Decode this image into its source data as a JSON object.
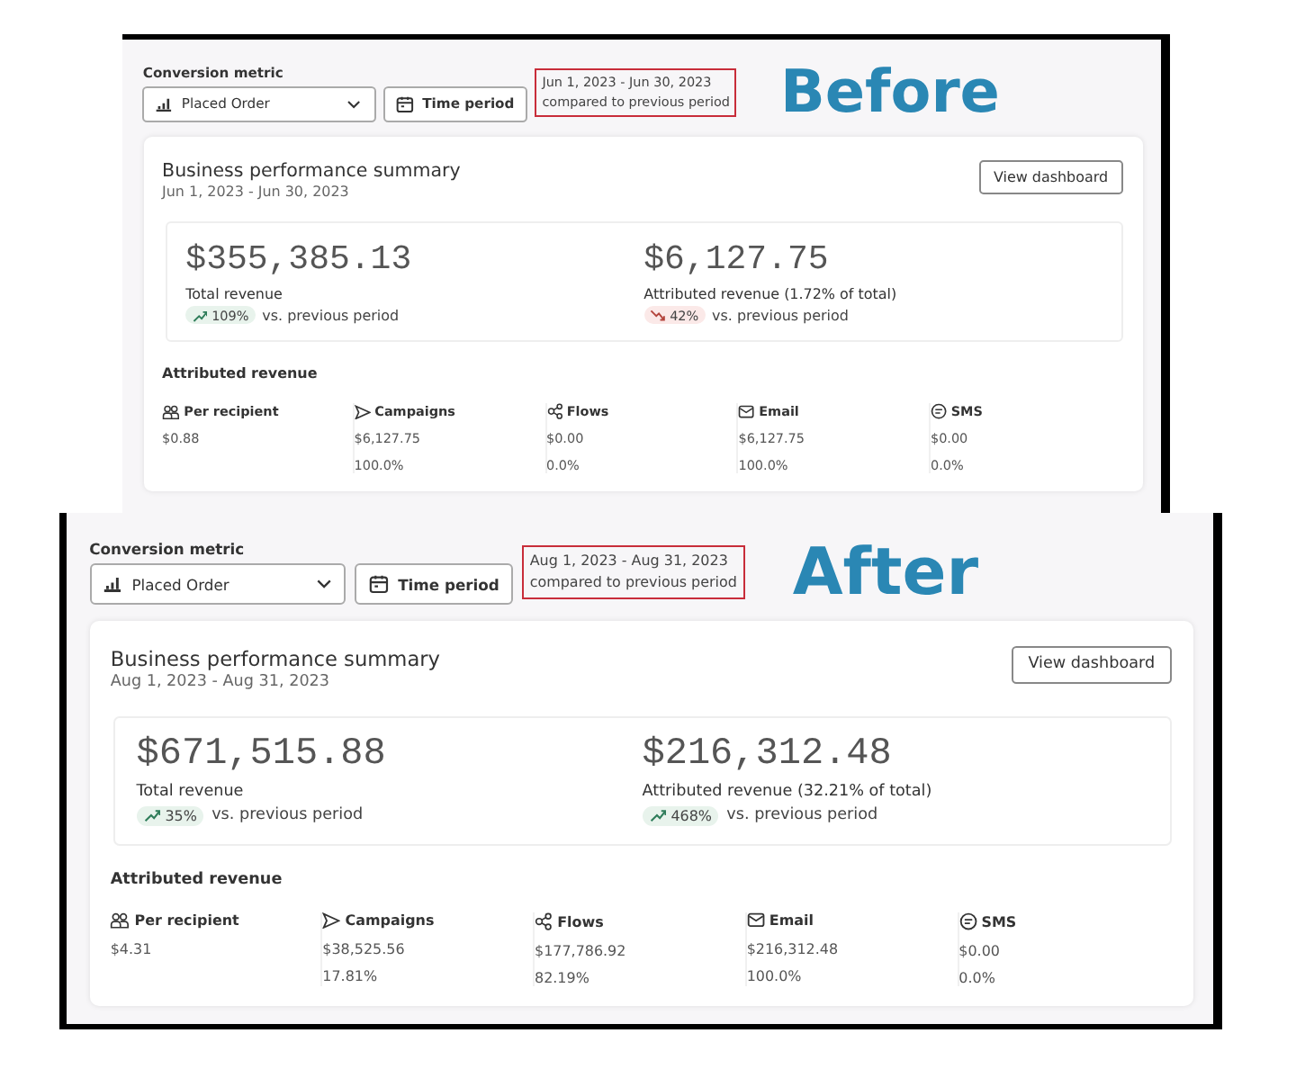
{
  "panels": [
    {
      "caption": "Before",
      "filters": {
        "label": "Conversion metric",
        "metric": "Placed Order",
        "time_button": "Time period",
        "date_range": "Jun 1, 2023 - Jun 30, 2023",
        "comparison": "compared to previous period"
      },
      "summary": {
        "title": "Business performance summary",
        "dates": "Jun 1, 2023 - Jun 30, 2023",
        "button": "View dashboard",
        "metrics": [
          {
            "value": "$355,385.13",
            "label": "Total revenue",
            "change": "109%",
            "rising": true,
            "comparison": "vs. previous period"
          },
          {
            "value": "$6,127.75",
            "label": "Attributed revenue (1.72% of total)",
            "change": "42%",
            "rising": false,
            "comparison": "vs. previous period"
          }
        ],
        "attributed": {
          "heading": "Attributed revenue",
          "channels": [
            {
              "kind": "recipient",
              "name": "Per recipient",
              "value": "$0.88"
            },
            {
              "kind": "campaigns",
              "name": "Campaigns",
              "value": "$6,127.75",
              "share": "100.0%"
            },
            {
              "kind": "flows",
              "name": "Flows",
              "value": "$0.00",
              "share": "0.0%"
            },
            {
              "kind": "email",
              "name": "Email",
              "value": "$6,127.75",
              "share": "100.0%"
            },
            {
              "kind": "sms",
              "name": "SMS",
              "value": "$0.00",
              "share": "0.0%"
            }
          ]
        }
      }
    },
    {
      "caption": "After",
      "filters": {
        "label": "Conversion metric",
        "metric": "Placed Order",
        "time_button": "Time period",
        "date_range": "Aug 1, 2023 - Aug 31, 2023",
        "comparison": "compared to previous period"
      },
      "summary": {
        "title": "Business performance summary",
        "dates": "Aug 1, 2023 - Aug 31, 2023",
        "button": "View dashboard",
        "metrics": [
          {
            "value": "$671,515.88",
            "label": "Total revenue",
            "change": "35%",
            "rising": true,
            "comparison": "vs. previous period"
          },
          {
            "value": "$216,312.48",
            "label": "Attributed revenue (32.21% of total)",
            "change": "468%",
            "rising": true,
            "comparison": "vs. previous period"
          }
        ],
        "attributed": {
          "heading": "Attributed revenue",
          "channels": [
            {
              "kind": "recipient",
              "name": "Per recipient",
              "value": "$4.31"
            },
            {
              "kind": "campaigns",
              "name": "Campaigns",
              "value": "$38,525.56",
              "share": "17.81%"
            },
            {
              "kind": "flows",
              "name": "Flows",
              "value": "$177,786.92",
              "share": "82.19%"
            },
            {
              "kind": "email",
              "name": "Email",
              "value": "$216,312.48",
              "share": "100.0%"
            },
            {
              "kind": "sms",
              "name": "SMS",
              "value": "$0.00",
              "share": "0.0%"
            }
          ]
        }
      }
    }
  ]
}
